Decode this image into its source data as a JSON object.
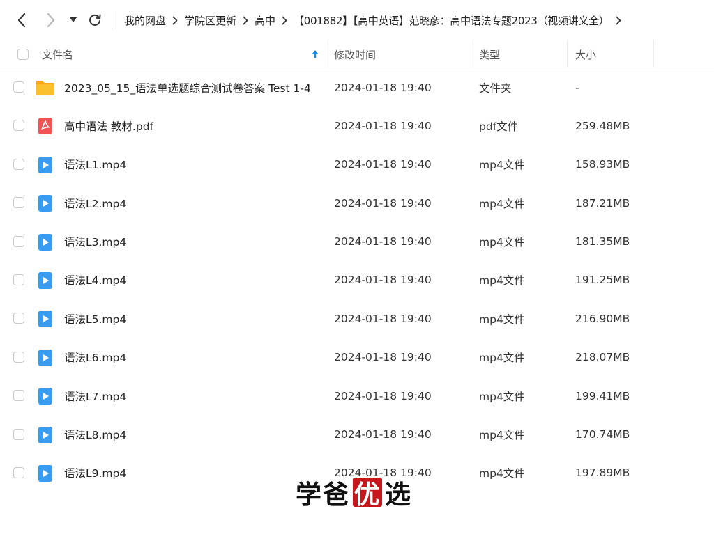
{
  "breadcrumb": [
    "我的网盘",
    "学院区更新",
    "高中",
    "【001882】【高中英语】范晓彦：高中语法专题2023（视频讲义全）"
  ],
  "columns": {
    "name": "文件名",
    "modified": "修改时间",
    "type": "类型",
    "size": "大小"
  },
  "files": [
    {
      "name": "2023_05_15_语法单选题综合测试卷答案 Test 1-4",
      "modified": "2024-01-18 19:40",
      "type": "文件夹",
      "size": "-",
      "icon": "folder-icon"
    },
    {
      "name": "高中语法 教材.pdf",
      "modified": "2024-01-18 19:40",
      "type": "pdf文件",
      "size": "259.48MB",
      "icon": "pdf-icon"
    },
    {
      "name": "语法L1.mp4",
      "modified": "2024-01-18 19:40",
      "type": "mp4文件",
      "size": "158.93MB",
      "icon": "video-icon"
    },
    {
      "name": "语法L2.mp4",
      "modified": "2024-01-18 19:40",
      "type": "mp4文件",
      "size": "187.21MB",
      "icon": "video-icon"
    },
    {
      "name": "语法L3.mp4",
      "modified": "2024-01-18 19:40",
      "type": "mp4文件",
      "size": "181.35MB",
      "icon": "video-icon"
    },
    {
      "name": "语法L4.mp4",
      "modified": "2024-01-18 19:40",
      "type": "mp4文件",
      "size": "191.25MB",
      "icon": "video-icon"
    },
    {
      "name": "语法L5.mp4",
      "modified": "2024-01-18 19:40",
      "type": "mp4文件",
      "size": "216.90MB",
      "icon": "video-icon"
    },
    {
      "name": "语法L6.mp4",
      "modified": "2024-01-18 19:40",
      "type": "mp4文件",
      "size": "218.07MB",
      "icon": "video-icon"
    },
    {
      "name": "语法L7.mp4",
      "modified": "2024-01-18 19:40",
      "type": "mp4文件",
      "size": "199.41MB",
      "icon": "video-icon"
    },
    {
      "name": "语法L8.mp4",
      "modified": "2024-01-18 19:40",
      "type": "mp4文件",
      "size": "170.74MB",
      "icon": "video-icon"
    },
    {
      "name": "语法L9.mp4",
      "modified": "2024-01-18 19:40",
      "type": "mp4文件",
      "size": "197.89MB",
      "icon": "video-icon"
    }
  ],
  "watermark": {
    "part1": "学爸",
    "seal": "优",
    "part2": "选"
  },
  "colors": {
    "accent": "#1e88e5",
    "folder": "#f9b91e",
    "pdf": "#f05454",
    "video": "#3a9cf0",
    "seal": "#c8161d"
  }
}
